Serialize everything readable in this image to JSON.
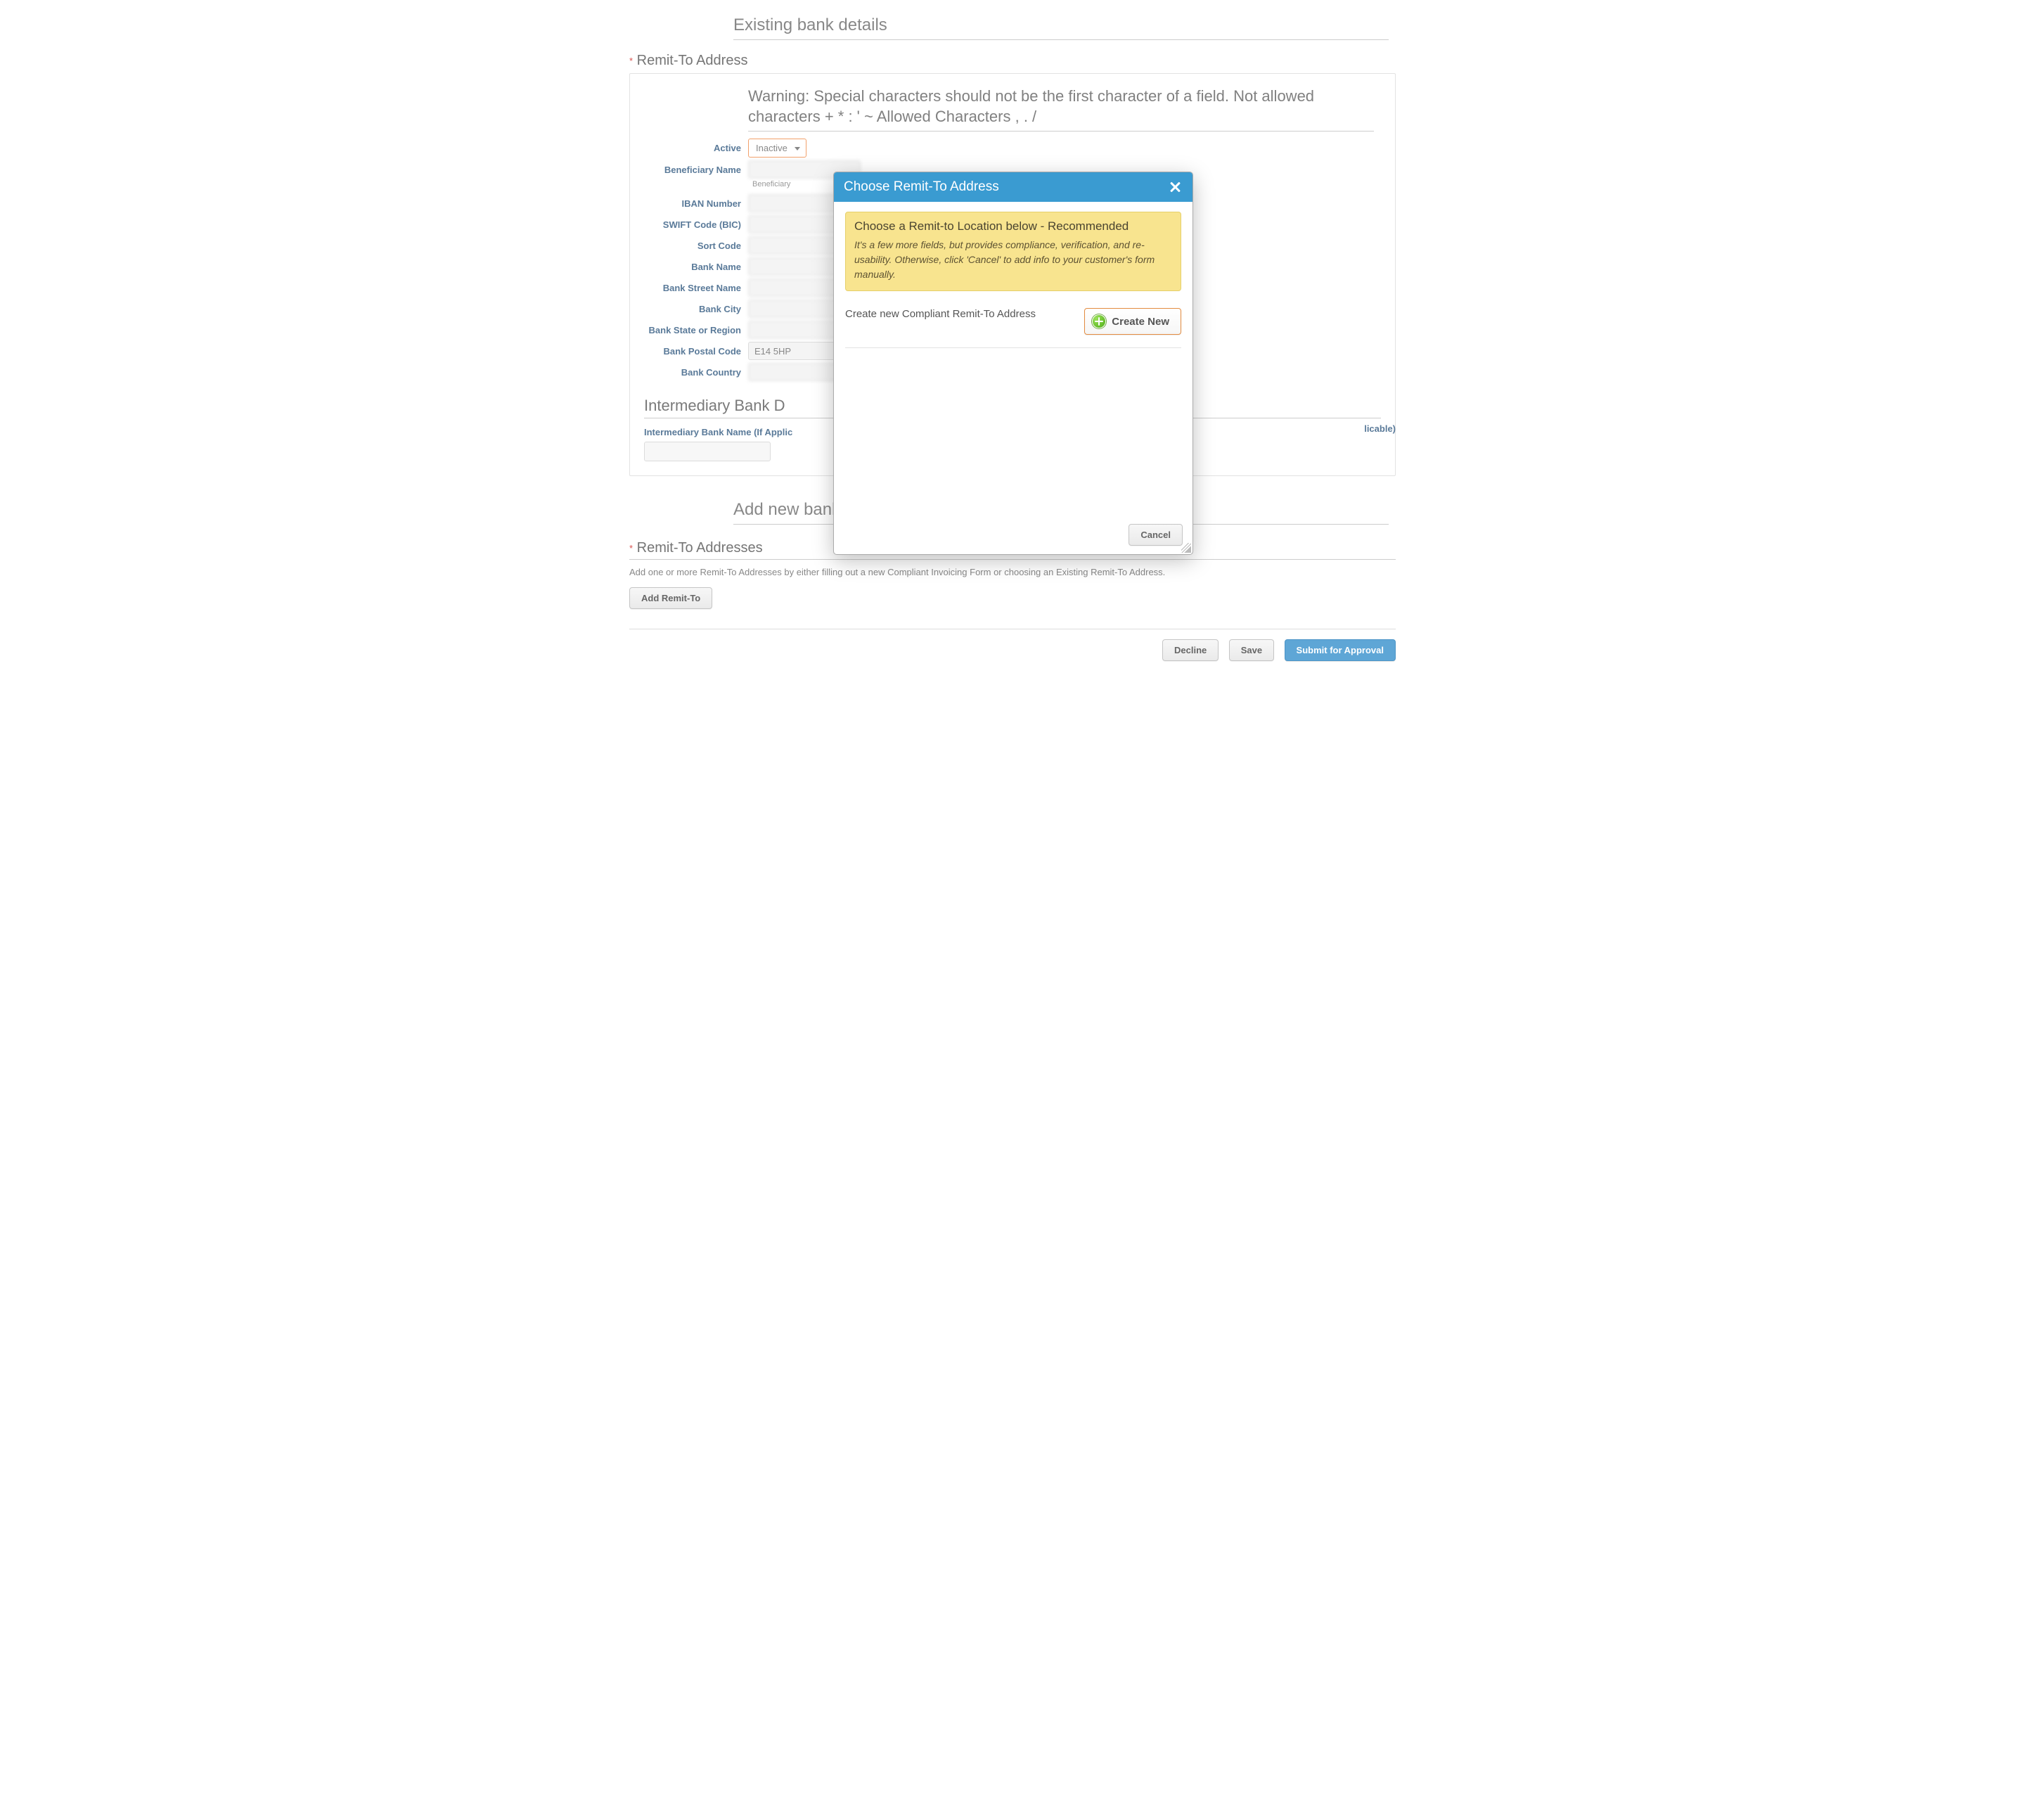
{
  "sections": {
    "existingBank": "Existing bank details",
    "addNewBank": "Add new bank details",
    "remitSection": "Remit-To Address",
    "remitAddresses": "Remit-To Addresses"
  },
  "warning": "Warning: Special characters should not be the first character of a field. Not allowed characters + * : ' ~ Allowed Characters , . /",
  "form": {
    "activeLabel": "Active",
    "activeValue": "Inactive",
    "beneficiaryLabel": "Beneficiary Name",
    "beneficiaryHelper": "Beneficiary",
    "ibanLabel": "IBAN Number",
    "swiftLabel": "SWIFT Code (BIC)",
    "sortLabel": "Sort Code",
    "bankNameLabel": "Bank Name",
    "bankStreetLabel": "Bank Street Name",
    "bankCityLabel": "Bank City",
    "bankStateLabel": "Bank State or Region",
    "bankPostalLabel": "Bank Postal Code",
    "bankPostalValue": "E14 5HP",
    "bankCountryLabel": "Bank Country"
  },
  "intermediary": {
    "title": "Intermediary Bank D",
    "nameLabel": "Intermediary Bank Name (If Applic",
    "rightObscured": "licable)"
  },
  "remitAdd": {
    "hint": "Add one or more Remit-To Addresses by either filling out a new Compliant Invoicing Form or choosing an Existing Remit-To Address.",
    "addButton": "Add Remit-To"
  },
  "footer": {
    "decline": "Decline",
    "save": "Save",
    "submit": "Submit for Approval"
  },
  "modal": {
    "title": "Choose Remit-To Address",
    "recTitle": "Choose a Remit-to Location below - Recommended",
    "recDesc": "It's a few more fields, but provides compliance, verification, and re-usability. Otherwise, click 'Cancel' to add info to your customer's form manually.",
    "createLabel": "Create new Compliant Remit-To Address",
    "createButton": "Create New",
    "cancel": "Cancel"
  }
}
